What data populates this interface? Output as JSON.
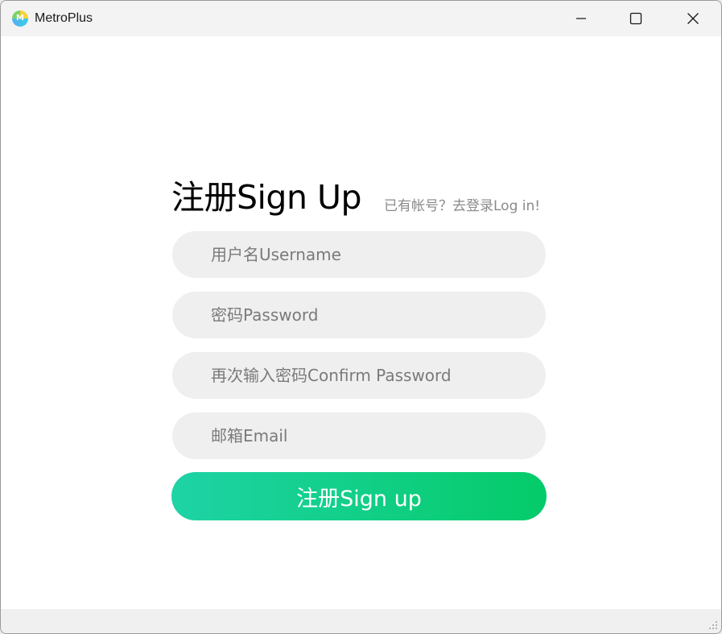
{
  "window": {
    "title": "MetroPlus",
    "icon": "metroplus-app-icon",
    "controls": [
      "minimize-icon",
      "maximize-icon",
      "close-icon"
    ]
  },
  "form": {
    "heading": "注册Sign Up",
    "login_link": "已有帐号？去登录Log in!",
    "fields": [
      {
        "name": "username",
        "placeholder": "用户名Username",
        "value": ""
      },
      {
        "name": "password",
        "placeholder": "密码Password",
        "value": ""
      },
      {
        "name": "confirm_password",
        "placeholder": "再次输入密码Confirm Password",
        "value": ""
      },
      {
        "name": "email",
        "placeholder": "邮箱Email",
        "value": ""
      }
    ],
    "submit_label": "注册Sign up"
  },
  "colors": {
    "field_background": "#efefef",
    "placeholder_text": "#7a7a7a",
    "button_gradient_start": "#1ed3a6",
    "button_gradient_end": "#05cb69",
    "link_text": "#8a8a8a"
  }
}
